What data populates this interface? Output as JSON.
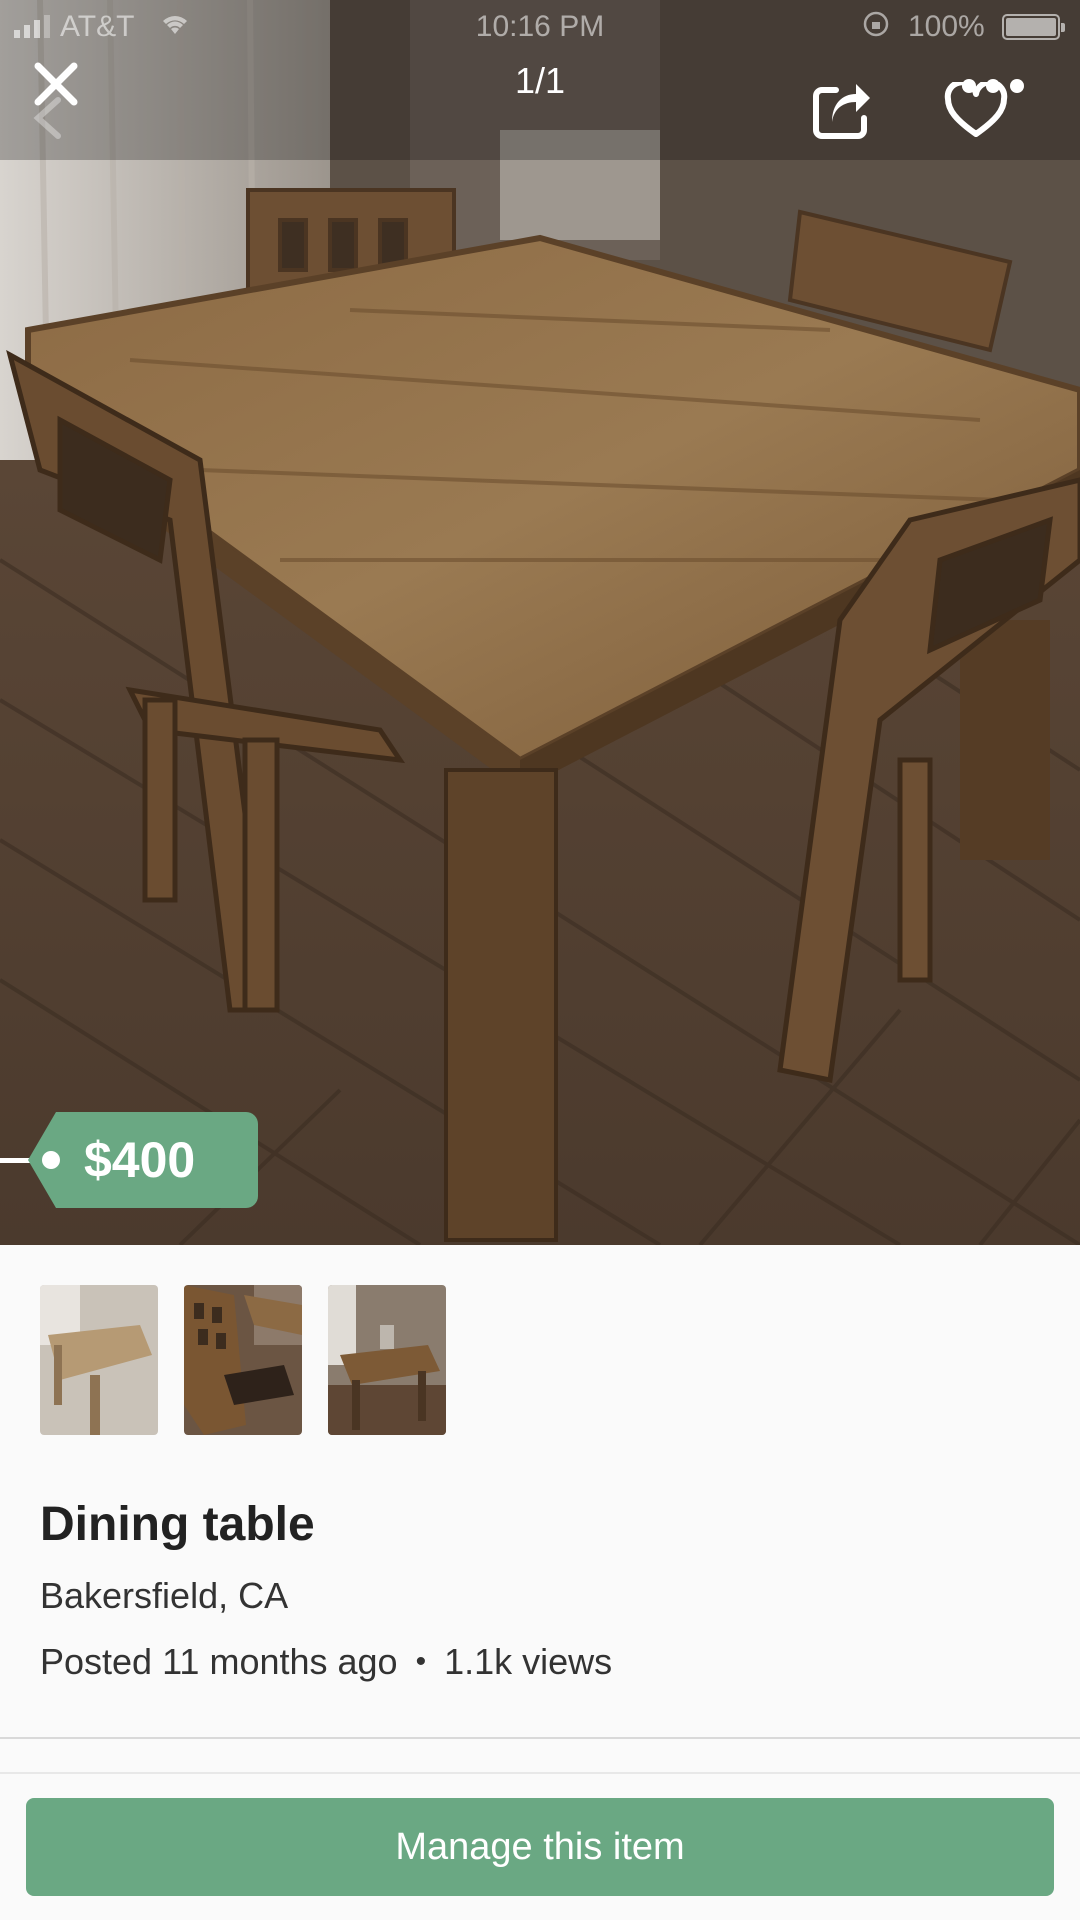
{
  "status_bar": {
    "carrier": "AT&T",
    "time": "10:16 PM",
    "battery": "100%",
    "battery_level": 1.0
  },
  "nav": {
    "counter": "1/1",
    "icons": [
      "close-icon",
      "back-chevron-icon",
      "share-icon",
      "heart-icon",
      "more-dots-icon"
    ]
  },
  "listing": {
    "price": "$400",
    "title": "Dining table",
    "location": "Bakersfield, CA",
    "posted": "Posted 11 months ago",
    "separator": "•",
    "views": "1.1k views",
    "thumbnail_count": 3
  },
  "actions": {
    "manage_label": "Manage this item"
  },
  "colors": {
    "accent": "#6aa883",
    "text_dark": "#222222",
    "panel_bg": "#fafafa"
  }
}
